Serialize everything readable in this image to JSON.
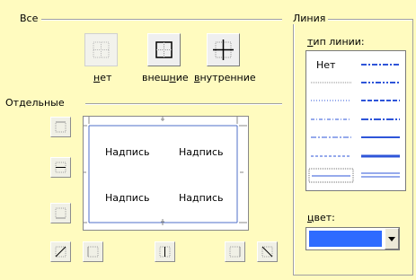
{
  "presets": {
    "group_label": "Все",
    "buttons": [
      {
        "id": "none",
        "label_pre": "",
        "label_u": "н",
        "label_post": "ет",
        "enabled": false
      },
      {
        "id": "outer",
        "label_pre": "внеш",
        "label_u": "н",
        "label_post": "ие",
        "enabled": true
      },
      {
        "id": "inner",
        "label_pre": "",
        "label_u": "в",
        "label_post": "нутренние",
        "enabled": true
      }
    ]
  },
  "individual": {
    "group_label": "Отдельные",
    "preview_cells": [
      "Надпись",
      "Надпись",
      "Надпись",
      "Надпись"
    ]
  },
  "line": {
    "group_label": "Линия",
    "type_label_u": "т",
    "type_label_rest": "ип линии:",
    "none_option": "Нет",
    "color_label_u": "ц",
    "color_label_rest": "вет:",
    "color_value": "#2E6BFF"
  },
  "colors": {
    "accent_line": "#2E55D9",
    "dim_line": "#8C8C8C",
    "preview_line": "#4F6FC8"
  }
}
